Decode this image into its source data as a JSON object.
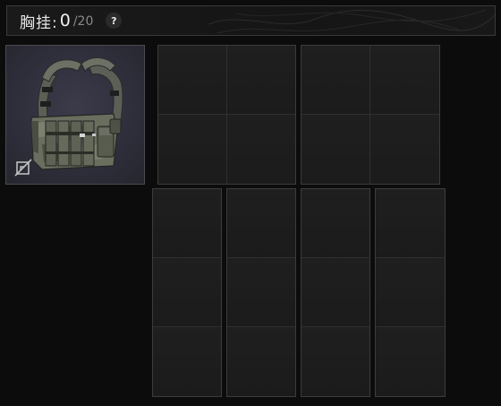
{
  "header": {
    "title": "胸挂:",
    "count": "0",
    "separator": "/",
    "capacity": "20",
    "help_label": "?"
  },
  "equipped_item": {
    "icon": "chest-rig-vest",
    "unequip_icon": "unequip-icon"
  },
  "containers": [
    {
      "name": "pouch-a",
      "cols": 2,
      "rows": 2
    },
    {
      "name": "pouch-b",
      "cols": 2,
      "rows": 2
    },
    {
      "name": "pouch-c",
      "cols": 1,
      "rows": 3
    },
    {
      "name": "pouch-d",
      "cols": 1,
      "rows": 3
    },
    {
      "name": "pouch-e",
      "cols": 1,
      "rows": 3
    },
    {
      "name": "pouch-f",
      "cols": 1,
      "rows": 3
    }
  ],
  "colors": {
    "background": "#0c0c0c",
    "slot_background": "#2f2f3c",
    "cell_background": "#1d1d1d",
    "border": "#3c3c3c"
  }
}
